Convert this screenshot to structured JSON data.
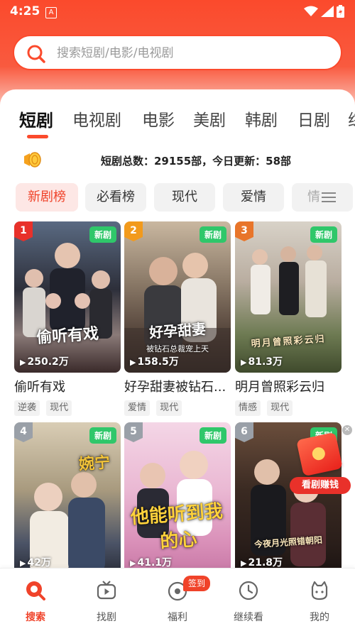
{
  "status_bar": {
    "time": "4:25",
    "app_badge": "A"
  },
  "search": {
    "placeholder": "搜索短剧/电影/电视剧"
  },
  "tabs": [
    {
      "label": "短剧",
      "active": true
    },
    {
      "label": "电视剧"
    },
    {
      "label": "电影"
    },
    {
      "label": "美剧"
    },
    {
      "label": "韩剧"
    },
    {
      "label": "日剧"
    },
    {
      "label": "综"
    }
  ],
  "stats": {
    "text": "短剧总数：29155部，今日更新：58部"
  },
  "chips": [
    {
      "label": "新剧榜",
      "active": true
    },
    {
      "label": "必看榜"
    },
    {
      "label": "现代"
    },
    {
      "label": "爱情"
    },
    {
      "label": "情"
    }
  ],
  "cards": [
    {
      "rank": "1",
      "badge": "新剧",
      "poster_text": "偷听有戏",
      "poster_sub": "",
      "views": "250.2万",
      "title": "偷听有戏",
      "tags": [
        "逆袭",
        "现代"
      ],
      "rank_color": "#e8312a"
    },
    {
      "rank": "2",
      "badge": "新剧",
      "poster_text": "好孕甜妻",
      "poster_sub": "被钻石总裁宠上天",
      "views": "158.5万",
      "title": "好孕甜妻被钻石...",
      "tags": [
        "爱情",
        "现代"
      ],
      "rank_color": "#f29a1c"
    },
    {
      "rank": "3",
      "badge": "新剧",
      "poster_text": "明月曾照彩云归",
      "poster_sub": "",
      "views": "81.3万",
      "title": "明月曾照彩云归",
      "tags": [
        "情感",
        "现代"
      ],
      "rank_color": "#e8752a"
    },
    {
      "rank": "4",
      "badge": "新剧",
      "poster_text": "婉宁",
      "poster_sub": "",
      "views": "42万",
      "title": "",
      "tags": [],
      "rank_color": "#9aa0a8"
    },
    {
      "rank": "5",
      "badge": "新剧",
      "poster_text": "他能听到我的心",
      "poster_sub": "",
      "views": "41.1万",
      "title": "",
      "tags": [],
      "rank_color": "#9aa0a8"
    },
    {
      "rank": "6",
      "badge": "新剧",
      "poster_text": "今夜月光照错朝阳",
      "poster_sub": "",
      "views": "21.8万",
      "title": "",
      "tags": [],
      "rank_color": "#9aa0a8"
    }
  ],
  "float_promo": {
    "label": "看剧赚钱"
  },
  "bottom_nav": [
    {
      "label": "搜索",
      "icon": "search-icon",
      "active": true
    },
    {
      "label": "找剧",
      "icon": "tv-icon"
    },
    {
      "label": "福利",
      "icon": "gift-icon",
      "badge": "签到"
    },
    {
      "label": "继续看",
      "icon": "clock-icon"
    },
    {
      "label": "我的",
      "icon": "profile-icon"
    }
  ],
  "colors": {
    "brand": "#fb4a2c",
    "new_badge": "#2fc76a"
  }
}
